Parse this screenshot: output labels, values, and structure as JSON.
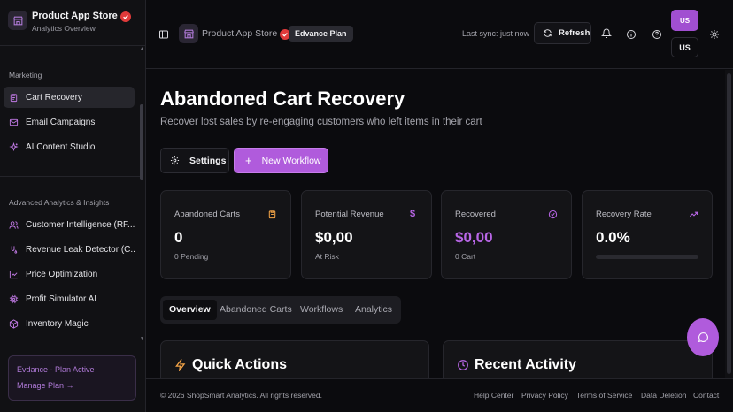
{
  "sidebar": {
    "brand_title": "Product App Store",
    "brand_subtitle": "Analytics Overview",
    "sections": [
      {
        "label": "Marketing",
        "items": [
          {
            "label": "Cart Recovery",
            "icon": "clipboard-icon",
            "active": true
          },
          {
            "label": "Email Campaigns",
            "icon": "mail-icon"
          },
          {
            "label": "AI Content Studio",
            "icon": "sparkles-icon"
          }
        ]
      },
      {
        "label": "Advanced Analytics & Insights",
        "items": [
          {
            "label": "Customer Intelligence (RF...",
            "icon": "users-icon"
          },
          {
            "label": "Revenue Leak Detector (C...",
            "icon": "leak-icon"
          },
          {
            "label": "Price Optimization",
            "icon": "line-chart-icon"
          },
          {
            "label": "Profit Simulator AI",
            "icon": "cpu-icon"
          },
          {
            "label": "Inventory Magic",
            "icon": "package-icon"
          }
        ]
      }
    ],
    "plan": {
      "title": "Evdance - Plan Active",
      "link": "Manage Plan →"
    }
  },
  "header": {
    "store_name": "Product App Store",
    "plan_chip": "Edvance Plan",
    "sync": "Last sync: just now",
    "refresh_label": "Refresh",
    "avatar": "US",
    "language": "US"
  },
  "main": {
    "title": "Abandoned Cart Recovery",
    "subtitle": "Recover lost sales by re-engaging customers who left items in their cart",
    "settings_label": "Settings",
    "new_workflow_label": "New Workflow",
    "stats": [
      {
        "label": "Abandoned Carts",
        "value": "0",
        "sub": "0 Pending",
        "icon": "cart-clipboard-icon",
        "color": "#f5a547"
      },
      {
        "label": "Potential Revenue",
        "value": "$0,00",
        "sub": "At Risk",
        "icon": "dollar-icon",
        "color": "#b866e6"
      },
      {
        "label": "Recovered",
        "value": "$0,00",
        "sub": "0 Cart",
        "icon": "check-circle-icon",
        "color": "#b866e6"
      },
      {
        "label": "Recovery Rate",
        "value": "0.0%",
        "progress": 0,
        "icon": "trending-up-icon",
        "color": "#b866e6"
      }
    ],
    "tabs": [
      "Overview",
      "Abandoned Carts",
      "Workflows",
      "Analytics"
    ],
    "panels": {
      "quick_actions": "Quick Actions",
      "recent_activity": "Recent Activity"
    }
  },
  "footer": {
    "copyright": "© 2026 ShopSmart Analytics.  All rights reserved.",
    "links": [
      "Help Center",
      "Privacy Policy",
      "Terms of Service",
      "Data Deletion",
      "Contact"
    ]
  },
  "colors": {
    "accent": "#b05bdc",
    "accent_text": "#b866e6",
    "verified": "#e03a3a",
    "warning": "#f5a547"
  }
}
